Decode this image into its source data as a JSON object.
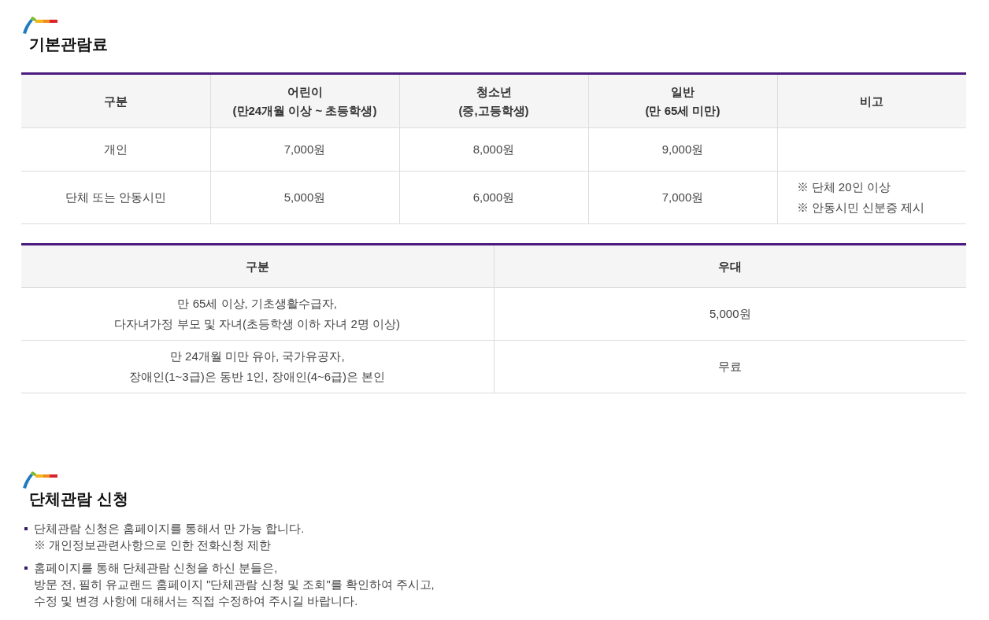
{
  "fee_section": {
    "title": "기본관람료",
    "table": {
      "columns": [
        "구분",
        "어린이\n(만24개월 이상 ~ 초등학생)",
        "청소년\n(중,고등학생)",
        "일반\n(만 65세 미만)",
        "비고"
      ],
      "rows": [
        {
          "cells": [
            "개인",
            "7,000원",
            "8,000원",
            "9,000원"
          ]
        },
        {
          "cells": [
            "단체 또는 안동시민",
            "5,000원",
            "6,000원",
            "7,000원",
            "※ 단체 20인 이상\n※ 안동시민 신분증 제시"
          ]
        }
      ]
    },
    "discount_table": {
      "columns": [
        "구분",
        "우대"
      ],
      "rows": [
        {
          "cells": [
            "만 65세 이상, 기초생활수급자,\n다자녀가정 부모 및 자녀(초등학생 이하 자녀 2명 이상)",
            "5,000원"
          ]
        },
        {
          "cells": [
            "만 24개월 미만 유아, 국가유공자,\n장애인(1~3급)은 동반 1인, 장애인(4~6급)은 본인",
            "무료"
          ]
        }
      ]
    }
  },
  "group_section": {
    "title": "단체관람 신청",
    "bullets": [
      "단체관람 신청은 홈페이지를 통해서 만 가능 합니다.\n※ 개인정보관련사항으로 인한 전화신청 제한",
      "홈페이지를 통해 단체관람 신청을 하신 분들은,\n방문 전, 필히 유교랜드 홈페이지 \"단체관람 신청 및 조회\"를 확인하여 주시고,\n수정 및 변경 사항에 대해서는 직접 수정하여 주시길 바랍니다."
    ]
  }
}
